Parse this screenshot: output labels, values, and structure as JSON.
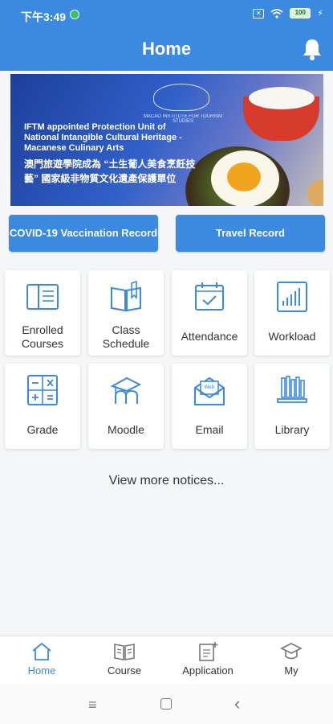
{
  "status_bar": {
    "time": "下午3:49",
    "battery": "100"
  },
  "header": {
    "title": "Home"
  },
  "banner": {
    "logo_text": "MACAO INSTITUTE FOR TOURISM STUDIES",
    "english_text": "IFTM appointed Protection Unit of National Intangible Cultural Heritage - Macanese Culinary Arts",
    "chinese_text": "澳門旅遊學院成為 “土生葡人美食烹飪技藝” 國家級非物質文化遺產保護單位"
  },
  "actions": {
    "covid": "COVID-19 Vaccination Record",
    "travel": "Travel Record"
  },
  "tiles": [
    {
      "label": "Enrolled Courses",
      "icon": "enrolled-courses-icon"
    },
    {
      "label": "Class Schedule",
      "icon": "class-schedule-icon"
    },
    {
      "label": "Attendance",
      "icon": "attendance-icon"
    },
    {
      "label": "Workload",
      "icon": "workload-icon"
    },
    {
      "label": "Grade",
      "icon": "grade-icon"
    },
    {
      "label": "Moodle",
      "icon": "moodle-icon"
    },
    {
      "label": "Email",
      "icon": "email-icon"
    },
    {
      "label": "Library",
      "icon": "library-icon"
    }
  ],
  "email_icon_text": "Web",
  "more_notices": "View more notices...",
  "tabs": [
    {
      "label": "Home",
      "icon": "home-icon",
      "active": true
    },
    {
      "label": "Course",
      "icon": "course-icon"
    },
    {
      "label": "Application",
      "icon": "application-icon"
    },
    {
      "label": "My",
      "icon": "my-icon"
    }
  ],
  "colors": {
    "primary": "#3b8ae0",
    "background": "#f5f6f8",
    "tile": "#ffffff"
  }
}
